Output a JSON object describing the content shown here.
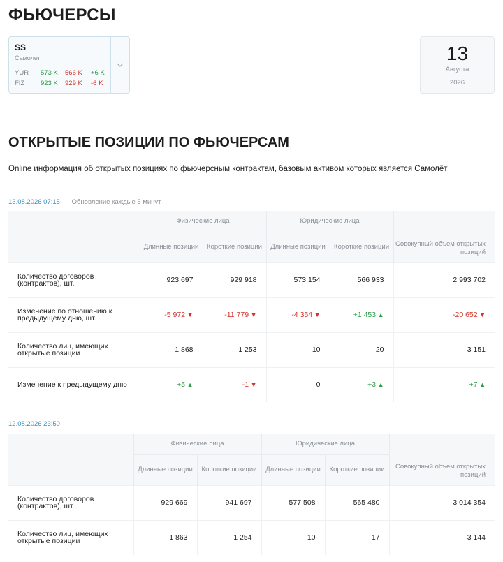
{
  "page_title": "ФЬЮЧЕРСЫ",
  "ticker": {
    "code": "SS",
    "name": "Самолет",
    "rows": [
      {
        "label": "YUR",
        "long": "573 K",
        "short": "566 K",
        "change": "+6 K",
        "change_sign": "pos"
      },
      {
        "label": "FIZ",
        "long": "923 K",
        "short": "929 K",
        "change": "-6 K",
        "change_sign": "neg"
      }
    ],
    "dropdown_icon": "chevron-down-icon"
  },
  "date": {
    "day": "13",
    "month": "Августа",
    "year": "2026"
  },
  "section": {
    "title": "ОТКРЫТЫЕ ПОЗИЦИИ ПО ФЬЮЧЕРСАМ",
    "description": "Online информация об открытых позициях по фьючерсным контрактам, базовым активом которых является Самолёт"
  },
  "table1": {
    "timestamp": "13.08.2026 07:15",
    "note": "Обновление каждые 5 минут",
    "group_phys": "Физические лица",
    "group_legal": "Юридические лица",
    "col_long": "Длинные позиции",
    "col_short": "Короткие позиции",
    "col_total": "Совокупный объем открытых позиций",
    "rows": [
      {
        "label": "Количество договоров (контрактов), шт.",
        "cells": [
          {
            "text": "923 697",
            "dir": ""
          },
          {
            "text": "929 918",
            "dir": ""
          },
          {
            "text": "573 154",
            "dir": ""
          },
          {
            "text": "566 933",
            "dir": ""
          },
          {
            "text": "2 993 702",
            "dir": ""
          }
        ]
      },
      {
        "label": "Изменение по отношению к предыдущему дню, шт.",
        "cells": [
          {
            "text": "-5 972",
            "dir": "down"
          },
          {
            "text": "-11 779",
            "dir": "down"
          },
          {
            "text": "-4 354",
            "dir": "down"
          },
          {
            "text": "+1 453",
            "dir": "up"
          },
          {
            "text": "-20 652",
            "dir": "down"
          }
        ]
      },
      {
        "label": "Количество лиц, имеющих открытые позиции",
        "cells": [
          {
            "text": "1 868",
            "dir": ""
          },
          {
            "text": "1 253",
            "dir": ""
          },
          {
            "text": "10",
            "dir": ""
          },
          {
            "text": "20",
            "dir": ""
          },
          {
            "text": "3 151",
            "dir": ""
          }
        ]
      },
      {
        "label": "Изменение к предыдущему дню",
        "cells": [
          {
            "text": "+5",
            "dir": "up"
          },
          {
            "text": "-1",
            "dir": "down"
          },
          {
            "text": "0",
            "dir": ""
          },
          {
            "text": "+3",
            "dir": "up"
          },
          {
            "text": "+7",
            "dir": "up"
          }
        ]
      }
    ]
  },
  "table2": {
    "timestamp": "12.08.2026 23:50",
    "group_phys": "Физические лица",
    "group_legal": "Юридические лица",
    "col_long": "Длинные позиции",
    "col_short": "Короткие позиции",
    "col_total": "Совокупный объем открытых позиций",
    "rows": [
      {
        "label": "Количество договоров (контрактов), шт.",
        "cells": [
          {
            "text": "929 669",
            "dir": ""
          },
          {
            "text": "941 697",
            "dir": ""
          },
          {
            "text": "577 508",
            "dir": ""
          },
          {
            "text": "565 480",
            "dir": ""
          },
          {
            "text": "3 014 354",
            "dir": ""
          }
        ]
      },
      {
        "label": "Количество лиц, имеющих открытые позиции",
        "cells": [
          {
            "text": "1 863",
            "dir": ""
          },
          {
            "text": "1 254",
            "dir": ""
          },
          {
            "text": "10",
            "dir": ""
          },
          {
            "text": "17",
            "dir": ""
          },
          {
            "text": "3 144",
            "dir": ""
          }
        ]
      }
    ]
  },
  "colors": {
    "positive": "#2e9b4a",
    "negative": "#d0342c",
    "timestamp": "#3b8fc2"
  }
}
